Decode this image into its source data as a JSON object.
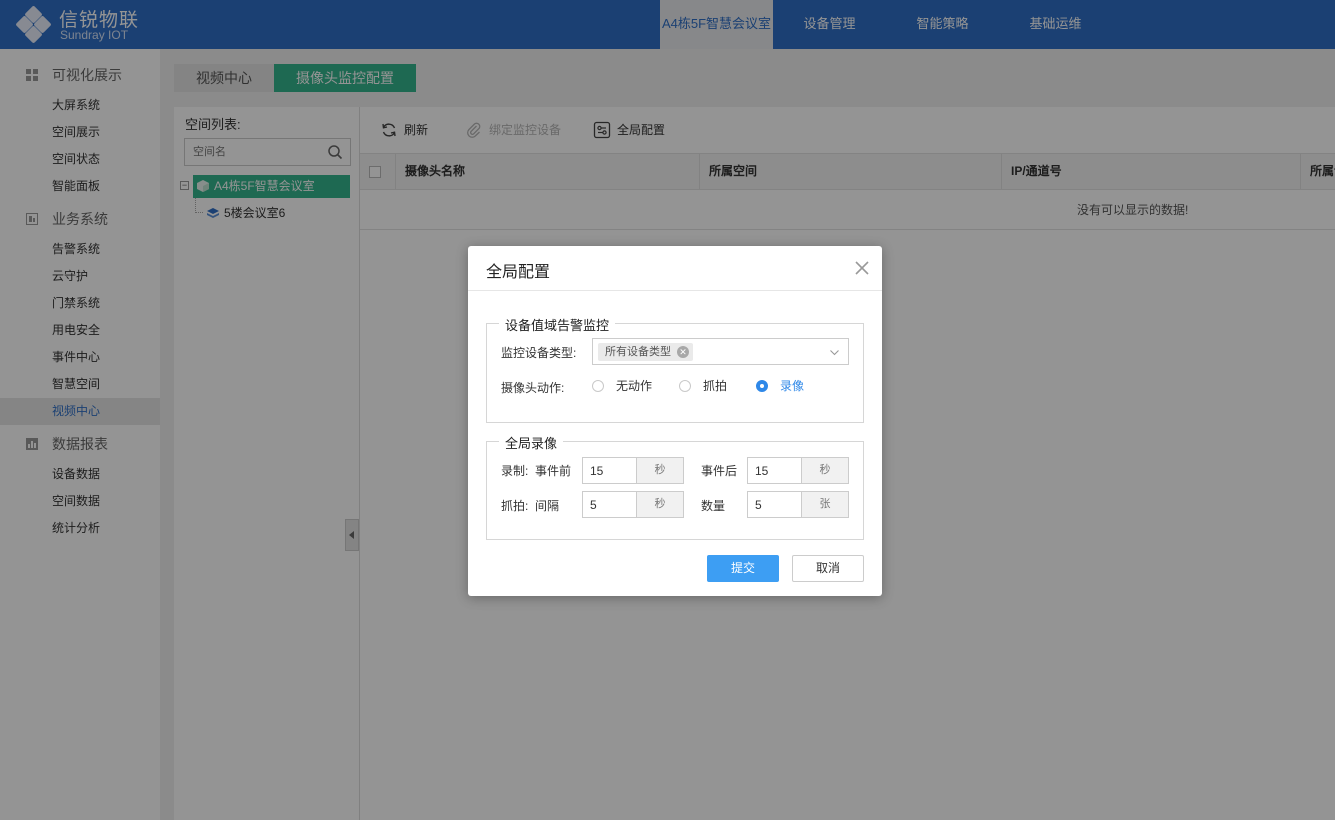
{
  "header": {
    "brand_title": "信锐物联",
    "brand_subtitle": "Sundray IOT",
    "nav": [
      {
        "label": "A4栋5F智慧会议室",
        "active": true
      },
      {
        "label": "设备管理"
      },
      {
        "label": "智能策略"
      },
      {
        "label": "基础运维"
      }
    ]
  },
  "sidebar": {
    "groups": [
      {
        "label": "可视化展示",
        "icon": "dashboard-icon",
        "items": [
          "大屏系统",
          "空间展示",
          "空间状态",
          "智能面板"
        ]
      },
      {
        "label": "业务系统",
        "icon": "business-icon",
        "items": [
          "告警系统",
          "云守护",
          "门禁系统",
          "用电安全",
          "事件中心",
          "智慧空间",
          "视频中心"
        ]
      },
      {
        "label": "数据报表",
        "icon": "chart-icon",
        "items": [
          "设备数据",
          "空间数据",
          "统计分析"
        ]
      }
    ],
    "active_item": "视频中心"
  },
  "tabs": [
    {
      "label": "视频中心"
    },
    {
      "label": "摄像头监控配置",
      "active": true
    }
  ],
  "space_panel": {
    "title": "空间列表:",
    "search_placeholder": "空间名",
    "tree_root": "A4栋5F智慧会议室",
    "tree_child": "5楼会议室6"
  },
  "toolbar": {
    "refresh": "刷新",
    "bind_device": "绑定监控设备",
    "global_config": "全局配置"
  },
  "grid": {
    "columns": [
      "摄像头名称",
      "所属空间",
      "IP/通道号",
      "所属设备"
    ],
    "empty_text": "没有可以显示的数据!"
  },
  "dialog": {
    "title": "全局配置",
    "section1": {
      "legend": "设备值域告警监控",
      "device_type_label": "监控设备类型:",
      "device_type_tag": "所有设备类型",
      "camera_action_label": "摄像头动作:",
      "options": [
        "无动作",
        "抓拍",
        "录像"
      ],
      "selected": "录像"
    },
    "section2": {
      "legend": "全局录像",
      "record_label": "录制:",
      "before_label": "事件前",
      "before_value": "15",
      "before_unit": "秒",
      "after_label": "事件后",
      "after_value": "15",
      "after_unit": "秒",
      "snap_label": "抓拍:",
      "interval_label": "间隔",
      "interval_value": "5",
      "interval_unit": "秒",
      "count_label": "数量",
      "count_value": "5",
      "count_unit": "张"
    },
    "submit": "提交",
    "cancel": "取消"
  },
  "colors": {
    "header_bg": "#2f6fc6",
    "accent_green": "#35b58e",
    "primary_blue": "#3d9ef3"
  }
}
